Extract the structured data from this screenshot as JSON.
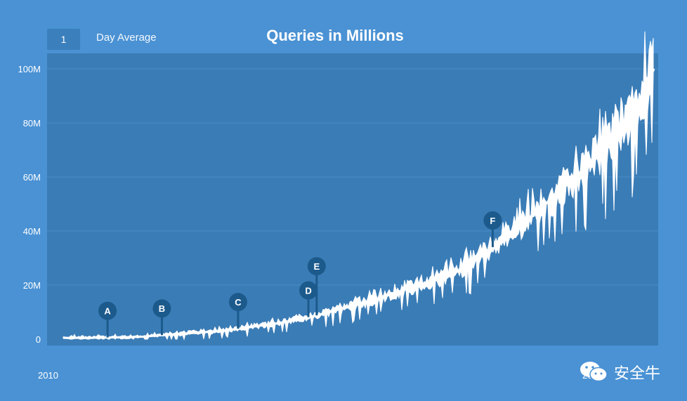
{
  "header": {
    "period_value": "1",
    "period_label": "Day Average"
  },
  "chart_data": {
    "type": "line",
    "title": "Queries in Millions",
    "xlabel": "",
    "ylabel": "",
    "x_tick_labels": [
      "2010",
      "20"
    ],
    "y_tick_labels": [
      "0",
      "20M",
      "40M",
      "60M",
      "80M",
      "100M"
    ],
    "ylim": [
      0,
      100
    ],
    "y_unit": "millions",
    "grid": true,
    "colors": {
      "background": "#4a92d4",
      "plot_area": "#3a7cb6",
      "line": "#ffffff",
      "marker": "#1c5a8c"
    },
    "series": [
      {
        "values": [
          0.5,
          0.5,
          0.6,
          0.7,
          0.9,
          1.5,
          2.0,
          2.5,
          3.0,
          4.0,
          5.0,
          6.0,
          7.5,
          9.0,
          11.0,
          13.0,
          15.0,
          17.5,
          20.0,
          22.0,
          25.0,
          30.0,
          35.0,
          41.0,
          47.0,
          53.0,
          60.0,
          67.0,
          75.0,
          83.0,
          100.0
        ]
      }
    ],
    "annotations": [
      {
        "label": "A",
        "position": 0.075
      },
      {
        "label": "B",
        "position": 0.167
      },
      {
        "label": "C",
        "position": 0.296
      },
      {
        "label": "D",
        "position": 0.415
      },
      {
        "label": "E",
        "position": 0.429
      },
      {
        "label": "F",
        "position": 0.727
      }
    ]
  },
  "watermark": {
    "text": "安全牛"
  }
}
